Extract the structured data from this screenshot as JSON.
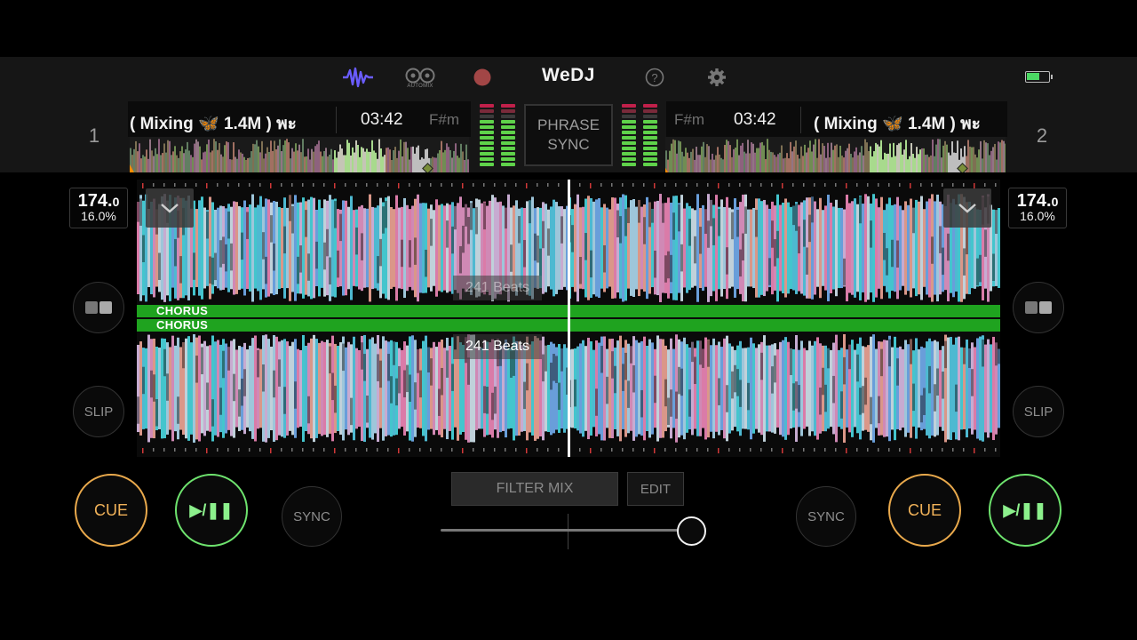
{
  "header": {
    "brand": "WeDJ",
    "automix_label": "AUTOMIX",
    "icons": [
      "waveform-icon",
      "automix-icon",
      "record-icon",
      "help-icon",
      "settings-icon",
      "battery-icon"
    ],
    "battery_level": 0.6
  },
  "decks": [
    {
      "number": "1",
      "title": "( Mixing 🦋 1.4M ) พะ",
      "time": "03:42",
      "key": "F#m",
      "bpm": "174.",
      "bpm_decimal": "0",
      "pitch": "16.0%",
      "cue_label": "CUE",
      "play_label": "▶/❚❚",
      "sync_label": "SYNC",
      "slip_label": "SLIP",
      "section_label": "CHORUS",
      "beats_label": "241 Beats"
    },
    {
      "number": "2",
      "title": "( Mixing 🦋 1.4M ) พะ",
      "time": "03:42",
      "key": "F#m",
      "bpm": "174.",
      "bpm_decimal": "0",
      "pitch": "16.0%",
      "cue_label": "CUE",
      "play_label": "▶/❚❚",
      "sync_label": "SYNC",
      "slip_label": "SLIP",
      "section_label": "CHORUS",
      "beats_label": "241 Beats"
    }
  ],
  "phrase_sync": {
    "line1": "PHRASE",
    "line2": "SYNC"
  },
  "mixer": {
    "filter_mix_label": "FILTER MIX",
    "edit_label": "EDIT",
    "crossfader_position": 1.0
  },
  "colors": {
    "cue": "#e9a94c",
    "play": "#6ee36e",
    "chorus": "#1fa31f",
    "waveform_cyan": "#4fe6f0",
    "waveform_pink": "#ff8fc4",
    "accent_purple": "#6a5cff"
  }
}
